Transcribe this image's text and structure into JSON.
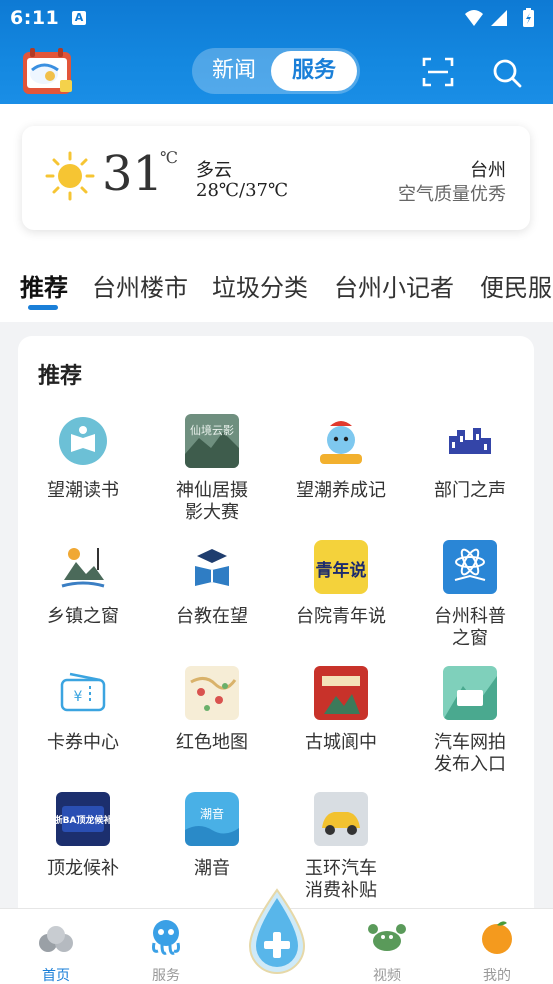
{
  "status_bar": {
    "time": "6:11",
    "notification_badge": "A"
  },
  "header": {
    "segment": {
      "news": "新闻",
      "service": "服务"
    },
    "colors": {
      "primary": "#1a7fd8"
    }
  },
  "weather": {
    "temperature": "31",
    "unit": "℃",
    "condition": "多云",
    "range": "28℃/37℃",
    "city": "台州",
    "air_quality": "空气质量优秀"
  },
  "tabs": [
    "推荐",
    "台州楼市",
    "垃圾分类",
    "台州小记者",
    "便民服"
  ],
  "recommend": {
    "title": "推荐",
    "items": [
      {
        "label": "望潮读书"
      },
      {
        "label": "神仙居摄\n影大赛"
      },
      {
        "label": "望潮养成记"
      },
      {
        "label": "部门之声"
      },
      {
        "label": "乡镇之窗"
      },
      {
        "label": "台教在望"
      },
      {
        "label": "台院青年说"
      },
      {
        "label": "台州科普\n之窗"
      },
      {
        "label": "卡券中心"
      },
      {
        "label": "红色地图"
      },
      {
        "label": "古城阆中"
      },
      {
        "label": "汽车网拍\n发布入口"
      },
      {
        "label": "顶龙候补"
      },
      {
        "label": "潮音"
      },
      {
        "label": "玉环汽车\n消费补贴"
      }
    ],
    "icon_texts": {
      "shenxianju": "仙境云影",
      "qingnianshuo": "青年说",
      "dinglong": "浙BA顶龙候补",
      "chaoyin": "潮音"
    }
  },
  "bottom_nav": {
    "items": [
      {
        "label": "首页",
        "active": true
      },
      {
        "label": "服务",
        "active": false
      },
      {
        "label": "视频",
        "active": false
      },
      {
        "label": "我的",
        "active": false
      }
    ]
  }
}
